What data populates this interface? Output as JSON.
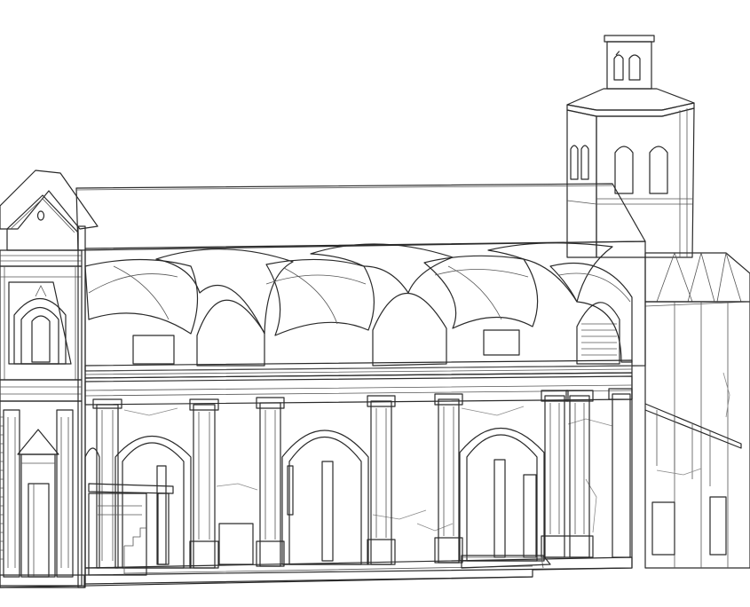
{
  "colors": {
    "background": "#ffffff",
    "line": "#2a2a2a",
    "wall": "#f3f3f3",
    "roof": "#ffffff",
    "vault": "#ececec",
    "shadow": "#c9c9c9",
    "deep_shadow": "#9a9a9a",
    "floor": "#dcdcdc"
  }
}
